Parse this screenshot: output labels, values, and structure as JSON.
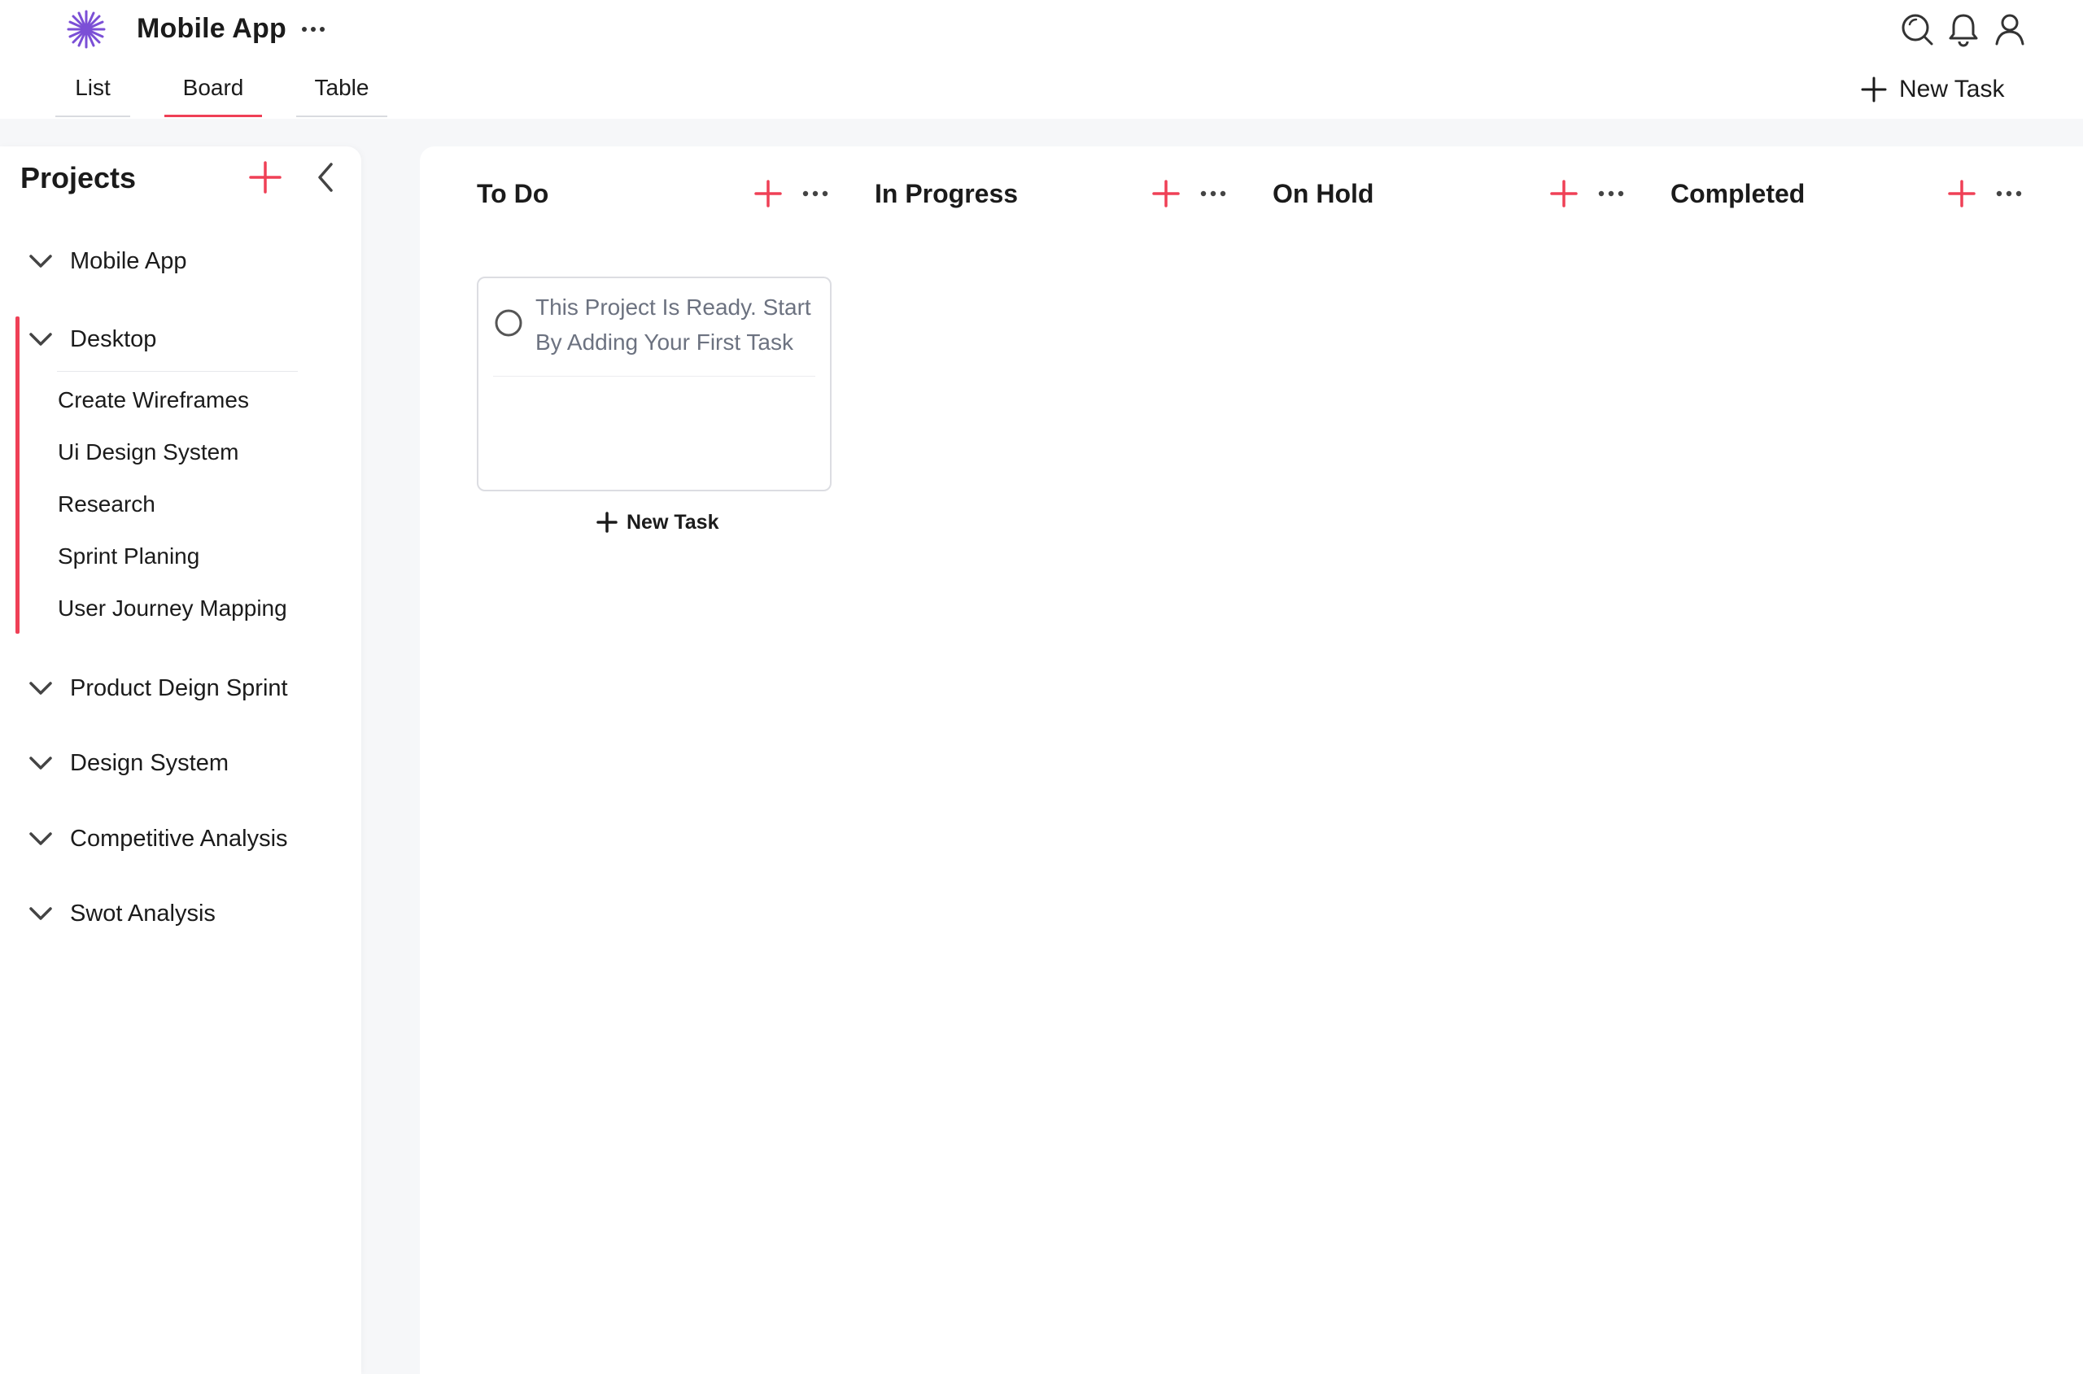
{
  "header": {
    "app_title": "Mobile App",
    "tabs": [
      {
        "label": "List",
        "active": false
      },
      {
        "label": "Board",
        "active": true
      },
      {
        "label": "Table",
        "active": false
      }
    ],
    "icons": [
      "search-icon",
      "bell-icon",
      "user-icon"
    ],
    "new_task_label": "New Task"
  },
  "sidebar": {
    "title": "Projects",
    "projects": [
      {
        "label": "Mobile App",
        "expanded": false
      },
      {
        "label": "Desktop",
        "expanded": true,
        "active": true,
        "items": [
          "Create Wireframes",
          "Ui Design System",
          "Research",
          "Sprint Planing",
          "User Journey Mapping"
        ]
      },
      {
        "label": "Product Deign Sprint",
        "expanded": false
      },
      {
        "label": "Design System",
        "expanded": false
      },
      {
        "label": "Competitive Analysis",
        "expanded": false
      },
      {
        "label": "Swot Analysis",
        "expanded": false
      }
    ]
  },
  "board": {
    "columns": [
      {
        "title": "To Do"
      },
      {
        "title": "In Progress"
      },
      {
        "title": "On Hold"
      },
      {
        "title": "Completed"
      }
    ],
    "placeholder_task": "This Project Is Ready. Start By Adding Your First Task",
    "new_task_label": "New Task"
  },
  "colors": {
    "accent": "#ef4056",
    "logo": "#7b4fd6",
    "text": "#1b1b1b",
    "muted_text": "#6c7280",
    "background": "#f6f7f9"
  }
}
